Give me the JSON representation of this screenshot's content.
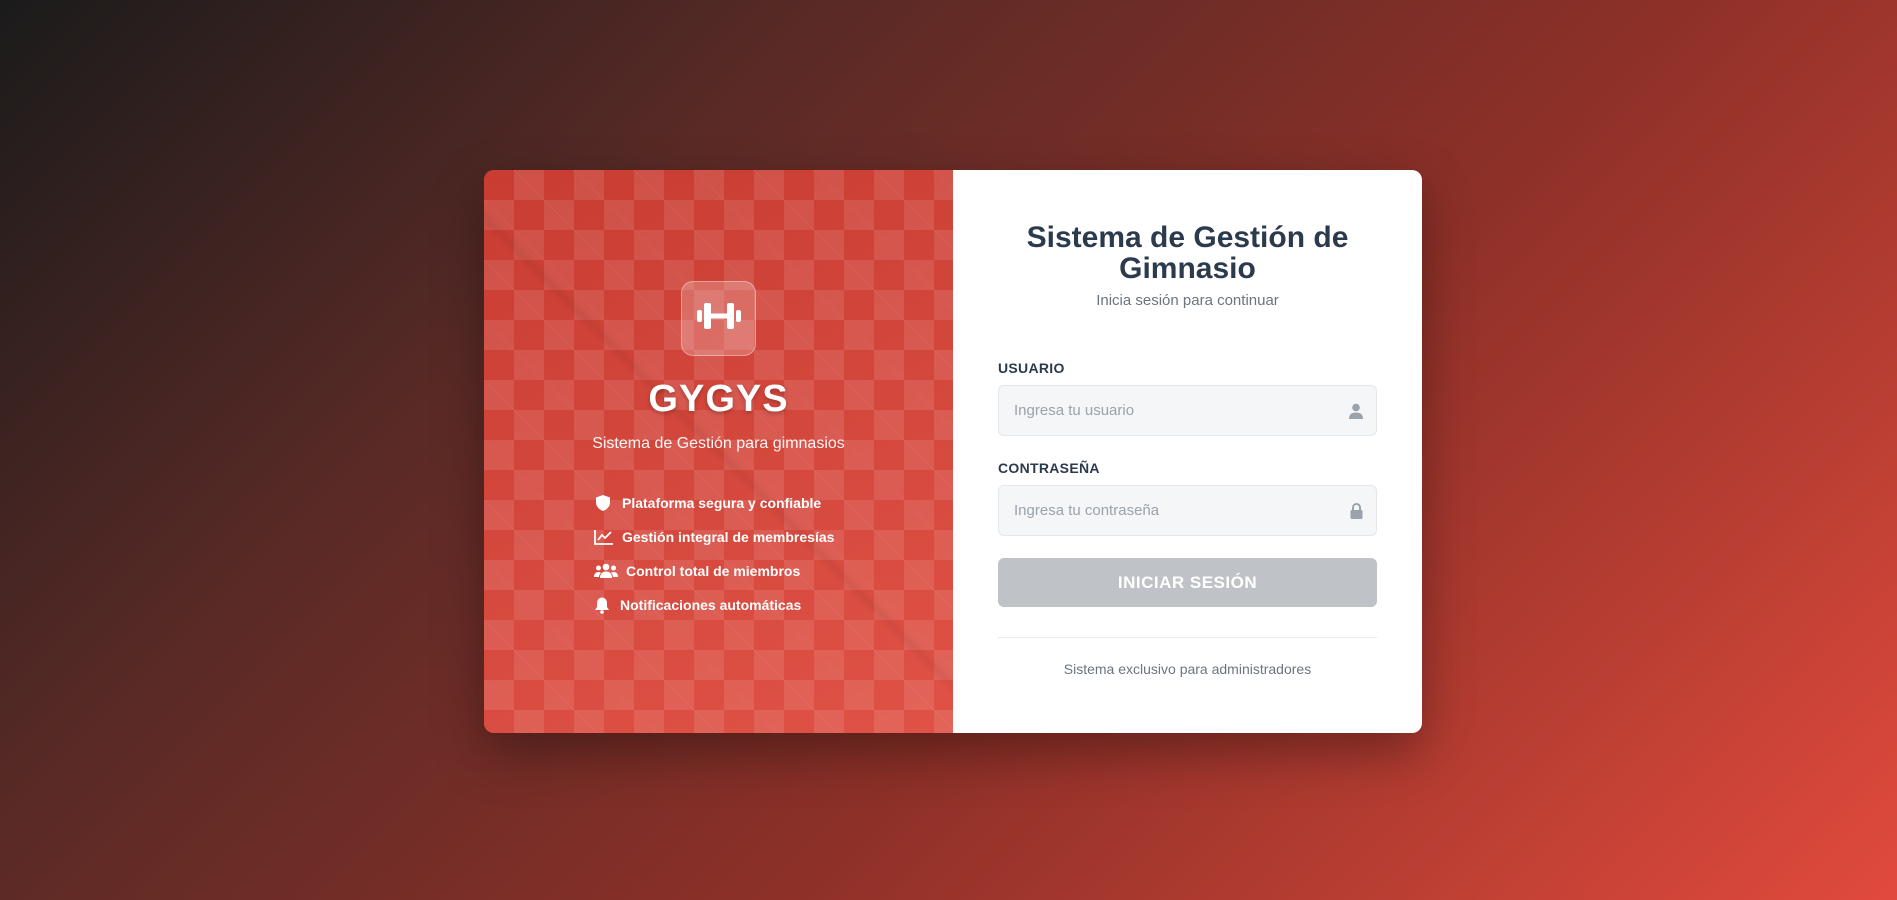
{
  "brand": {
    "name": "GYGYS",
    "tagline": "Sistema de Gestión para gimnasios",
    "logo_icon": "dumbbell-icon"
  },
  "features": [
    {
      "icon": "shield-icon",
      "label": "Plataforma segura y confiable"
    },
    {
      "icon": "chart-line-icon",
      "label": "Gestión integral de membresías"
    },
    {
      "icon": "users-icon",
      "label": "Control total de miembros"
    },
    {
      "icon": "bell-icon",
      "label": "Notificaciones automáticas"
    }
  ],
  "login": {
    "title": "Sistema de Gestión de Gimnasio",
    "subtitle": "Inicia sesión para continuar",
    "username": {
      "label": "USUARIO",
      "placeholder": "Ingresa tu usuario",
      "value": "",
      "icon": "user-icon"
    },
    "password": {
      "label": "CONTRASEÑA",
      "placeholder": "Ingresa tu contraseña",
      "value": "",
      "icon": "lock-icon"
    },
    "submit_label": "INICIAR SESIÓN",
    "footer_note": "Sistema exclusivo para administradores"
  },
  "colors": {
    "accent": "#d2483c",
    "title_text": "#2c3a4d",
    "button_disabled": "#bfc3c7"
  }
}
